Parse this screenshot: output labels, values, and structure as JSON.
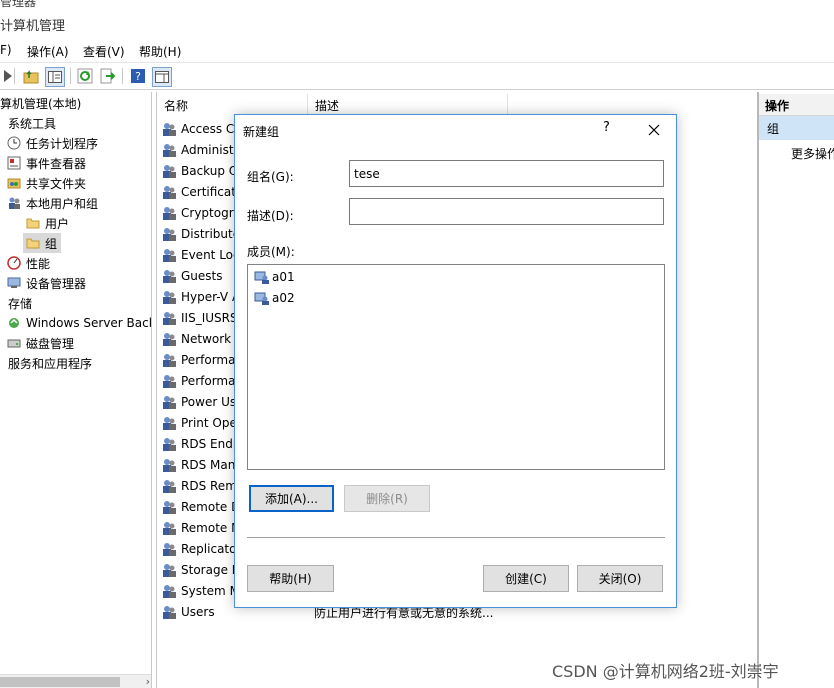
{
  "window": {
    "cut_title": "管理器",
    "title": "计算机管理"
  },
  "menu": [
    "F)",
    "操作(A)",
    "查看(V)",
    "帮助(H)"
  ],
  "toolbar_icons": [
    "forward-icon",
    "up-folder-icon",
    "show-tree-icon",
    "refresh-icon",
    "export-icon",
    "help-icon",
    "properties-icon"
  ],
  "tree": [
    {
      "label": "算机管理(本地)",
      "icon": ""
    },
    {
      "label": "系统工具",
      "icon": ""
    },
    {
      "label": "任务计划程序",
      "icon": "clock-icon"
    },
    {
      "label": "事件查看器",
      "icon": "event-viewer-icon"
    },
    {
      "label": "共享文件夹",
      "icon": "shared-folder-icon"
    },
    {
      "label": "本地用户和组",
      "icon": "users-icon"
    },
    {
      "label": "用户",
      "icon": "folder-icon"
    },
    {
      "label": "组",
      "icon": "folder-icon"
    },
    {
      "label": "性能",
      "icon": "performance-icon"
    },
    {
      "label": "设备管理器",
      "icon": "device-manager-icon"
    },
    {
      "label": "存储",
      "icon": ""
    },
    {
      "label": "Windows Server Back",
      "icon": "backup-icon"
    },
    {
      "label": "磁盘管理",
      "icon": "disk-icon"
    },
    {
      "label": "服务和应用程序",
      "icon": ""
    }
  ],
  "list": {
    "columns": [
      "名称",
      "描述"
    ],
    "rows": [
      "Access Co",
      "Administr",
      "Backup O",
      "Certificat",
      "Cryptogra",
      "Distribute",
      "Event Log",
      "Guests",
      "Hyper-V A",
      "IIS_IUSRS",
      "Network",
      "Performa",
      "Performa",
      "Power Us",
      "Print Ope",
      "RDS Endp",
      "RDS Man",
      "RDS Rem",
      "Remote D",
      "Remote M",
      "Replicato",
      "Storage R",
      "System M",
      "Users"
    ],
    "last_desc": "防止用户进行有意或无意的系统..."
  },
  "actions": {
    "header": "操作",
    "group": "组",
    "more": "更多操作"
  },
  "dialog": {
    "title": "新建组",
    "help": "?",
    "name_label": "组名(G):",
    "name_value": "tese",
    "desc_label": "描述(D):",
    "desc_value": "",
    "members_label": "成员(M):",
    "members": [
      "a01",
      "a02"
    ],
    "add": "添加(A)...",
    "remove": "删除(R)",
    "help_btn": "帮助(H)",
    "create": "创建(C)",
    "close": "关闭(O)"
  },
  "watermark": "CSDN @计算机网络2班-刘崇宇"
}
